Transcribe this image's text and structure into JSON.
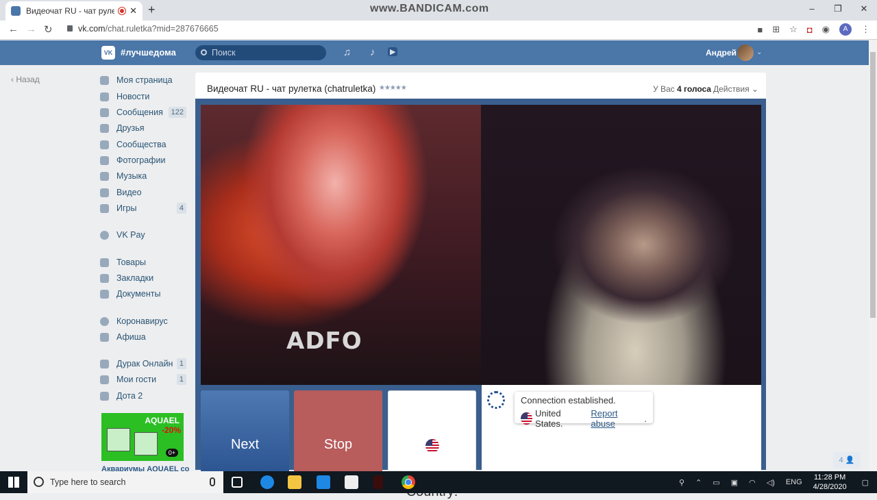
{
  "browser": {
    "tab_title": "Видеочат RU - чат рулетка (",
    "tab_close": "✕",
    "new_tab": "+",
    "watermark": "www.BANDICAM.com",
    "window_controls": [
      "–",
      "❐",
      "✕"
    ],
    "url_domain": "vk.com",
    "url_path": "/chat.ruletka?mid=287676665",
    "account_initial": "A"
  },
  "vk_header": {
    "brand": "#лучшедома",
    "logo": "VK",
    "search_placeholder": "Поиск",
    "user_name": "Андрей"
  },
  "left_nav": {
    "back_label": "Назад",
    "items": [
      {
        "label": "Моя страница",
        "count": ""
      },
      {
        "label": "Новости",
        "count": ""
      },
      {
        "label": "Сообщения",
        "count": "122"
      },
      {
        "label": "Друзья",
        "count": ""
      },
      {
        "label": "Сообщества",
        "count": ""
      },
      {
        "label": "Фотографии",
        "count": ""
      },
      {
        "label": "Музыка",
        "count": ""
      },
      {
        "label": "Видео",
        "count": ""
      },
      {
        "label": "Игры",
        "count": "4"
      },
      {
        "label": "VK Pay",
        "count": ""
      },
      {
        "label": "Товары",
        "count": ""
      },
      {
        "label": "Закладки",
        "count": ""
      },
      {
        "label": "Документы",
        "count": ""
      },
      {
        "label": "Коронавирус",
        "count": ""
      },
      {
        "label": "Афиша",
        "count": ""
      },
      {
        "label": "Дурак Онлайн",
        "count": "1"
      },
      {
        "label": "Мои гости",
        "count": "1"
      },
      {
        "label": "Дота 2",
        "count": ""
      }
    ],
    "ad": {
      "brand": "AQUAEL",
      "discount": "-20%",
      "age": "0+",
      "title": "Аквариумы AQUAEL со"
    }
  },
  "app": {
    "title": "Видеочат RU - чат рулетка (chatruletka)",
    "stars": "★★★★★",
    "votes_prefix": "У Вас ",
    "votes_count": "4 голоса",
    "actions_label": "Действия ⌄",
    "shirt_text": "ADFO",
    "next_label": "Next",
    "stop_label": "Stop",
    "country_label": "Country:",
    "chat": {
      "status": "Connection established.",
      "country": "United States.",
      "report": "Report abuse",
      "period": "."
    },
    "online_count": "4"
  },
  "taskbar": {
    "search_placeholder": "Type here to search",
    "lang": "ENG",
    "time": "11:28 PM",
    "date": "4/28/2020"
  }
}
